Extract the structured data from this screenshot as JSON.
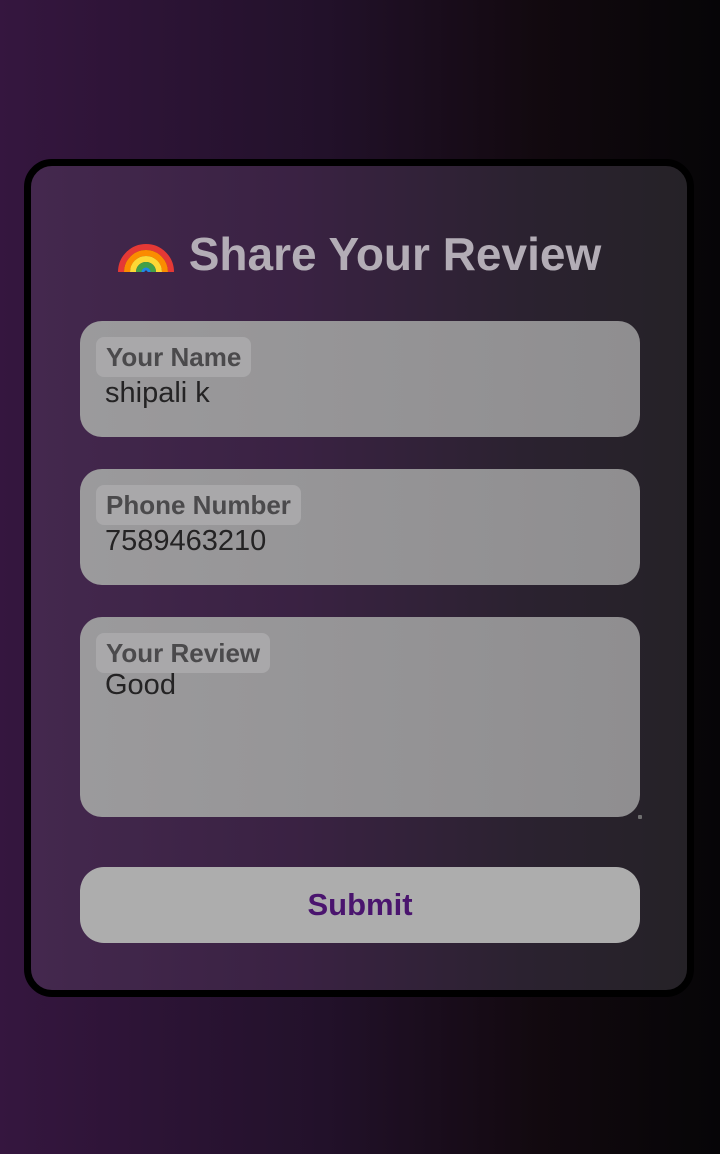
{
  "form": {
    "title": "Share Your Review",
    "title_icon": "rainbow-emoji-icon",
    "fields": {
      "name": {
        "label": "Your Name",
        "value": "shipali k"
      },
      "phone": {
        "label": "Phone Number",
        "value": "7589463210"
      },
      "review": {
        "label": "Your Review",
        "value": "Good"
      }
    },
    "submit_label": "Submit"
  },
  "colors": {
    "accent_text": "#4a146e",
    "background_left": "#35163f",
    "background_right": "#060507"
  }
}
